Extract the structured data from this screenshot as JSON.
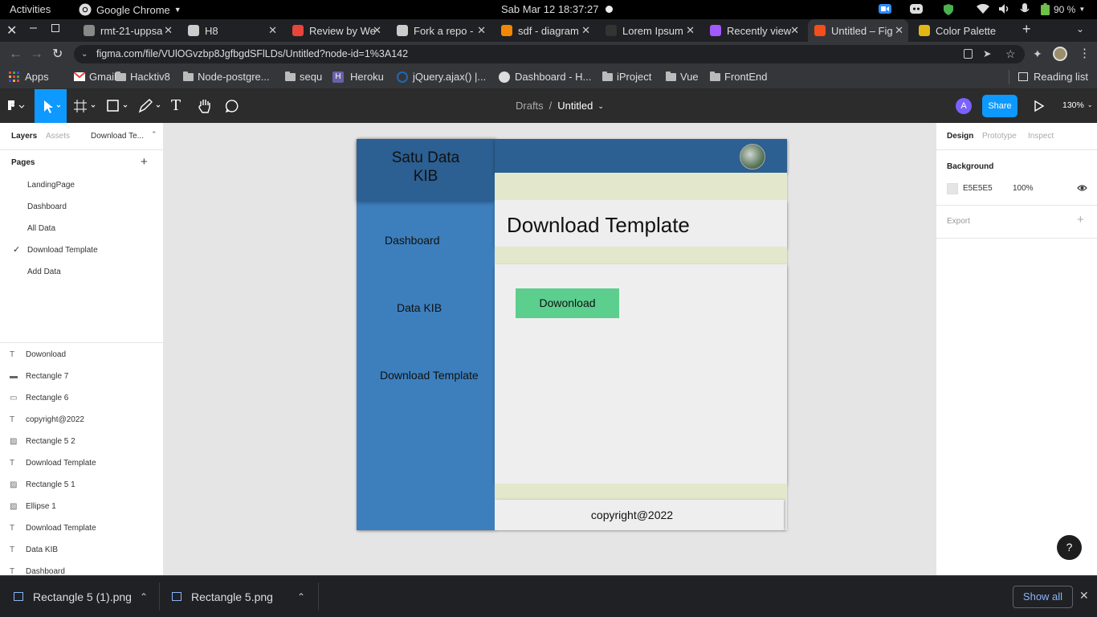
{
  "system_bar": {
    "activities": "Activities",
    "app_name": "Google Chrome",
    "datetime": "Sab Mar 12  18:37:27",
    "battery": "90 %"
  },
  "tabs": [
    {
      "title": "rmt-21-uppsa",
      "favicon_color": "#888888"
    },
    {
      "title": "H8",
      "favicon_color": "#cccccc"
    },
    {
      "title": "Review by We",
      "favicon_color": "#e8453c"
    },
    {
      "title": "Fork a repo -",
      "favicon_color": "#cccccc"
    },
    {
      "title": "sdf - diagram",
      "favicon_color": "#f08705"
    },
    {
      "title": "Lorem Ipsum",
      "favicon_color": "#333333"
    },
    {
      "title": "Recently view",
      "favicon_color": "#a259ff"
    },
    {
      "title": "Untitled – Fig",
      "favicon_color": "#f24e1e"
    },
    {
      "title": "Color Palette",
      "favicon_color": "#e2b714"
    }
  ],
  "address_bar": {
    "url": "figma.com/file/VUlOGvzbp8JgfbgdSFlLDs/Untitled?node-id=1%3A142"
  },
  "bookmarks": {
    "items": [
      "Apps",
      "Gmail",
      "Hacktiv8",
      "Node-postgre...",
      "sequ",
      "Heroku",
      "jQuery.ajax() |...",
      "Dashboard - H...",
      "iProject",
      "Vue",
      "FrontEnd"
    ],
    "reading_list": "Reading list"
  },
  "figma_toolbar": {
    "breadcrumb_parent": "Drafts",
    "breadcrumb_sep": "/",
    "file_name": "Untitled",
    "avatar_letter": "A",
    "share_label": "Share",
    "zoom": "130%"
  },
  "left_panel": {
    "tabs": [
      "Layers",
      "Assets",
      "Download Te..."
    ],
    "pages_heading": "Pages",
    "pages": [
      "LandingPage",
      "Dashboard",
      "All Data",
      "Download Template",
      "Add Data"
    ],
    "current_page_index": 3,
    "layers": [
      {
        "name": "Dowonload",
        "type": "T"
      },
      {
        "name": "Rectangle 7",
        "type": "line"
      },
      {
        "name": "Rectangle 6",
        "type": "rect"
      },
      {
        "name": "copyright@2022",
        "type": "T"
      },
      {
        "name": "Rectangle 5 2",
        "type": "image"
      },
      {
        "name": "Download Template",
        "type": "T"
      },
      {
        "name": "Rectangle 5 1",
        "type": "image"
      },
      {
        "name": "Ellipse 1",
        "type": "image"
      },
      {
        "name": "Download Template",
        "type": "T"
      },
      {
        "name": "Data KIB",
        "type": "T"
      },
      {
        "name": "Dashboard",
        "type": "T"
      }
    ]
  },
  "frame": {
    "brand": "Satu Data\nKIB",
    "nav": [
      "Dashboard",
      "Data KIB",
      "Download Template"
    ],
    "heading": "Download Template",
    "download_button": "Dowonload",
    "footer": "copyright@2022",
    "colors": {
      "sidebar": "#3d7fbd",
      "sidebar_top": "#2c5f92",
      "header": "#2c5f92",
      "stripe": "#e3e8cd",
      "panel": "#eeeeee",
      "button": "#5cce8e"
    }
  },
  "right_panel": {
    "tabs": [
      "Design",
      "Prototype",
      "Inspect"
    ],
    "background_heading": "Background",
    "bg_hex": "E5E5E5",
    "bg_opacity": "100%",
    "export_heading": "Export"
  },
  "downloads": {
    "files": [
      "Rectangle 5 (1).png",
      "Rectangle 5.png"
    ],
    "show_all": "Show all"
  },
  "help_label": "?"
}
